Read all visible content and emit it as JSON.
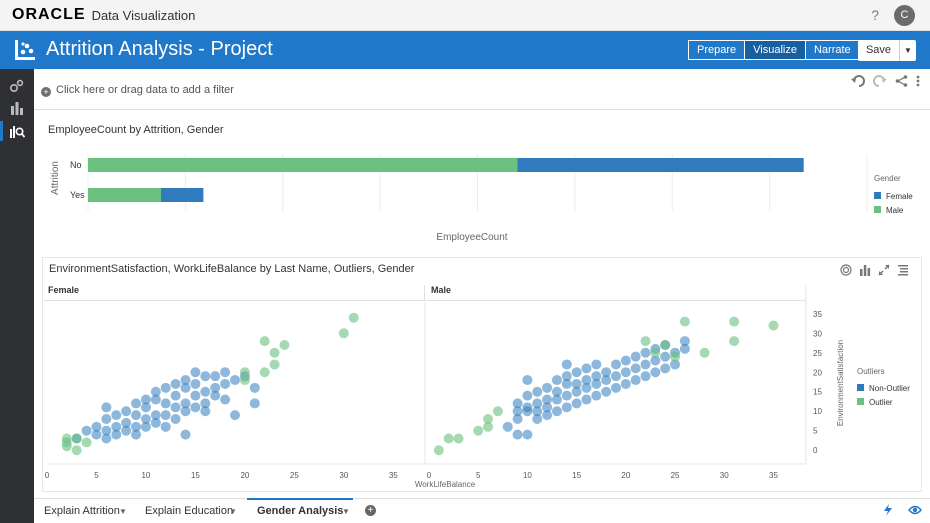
{
  "app": {
    "brand": "ORACLE",
    "product": "Data Visualization",
    "help": "?",
    "user_initial": "C"
  },
  "project": {
    "title": "Attrition Analysis - Project",
    "modes": [
      "Prepare",
      "Visualize",
      "Narrate"
    ],
    "active_mode": "Visualize",
    "save_label": "Save"
  },
  "rail": {
    "items": [
      "data-icon",
      "visualize-icon",
      "explain-icon"
    ]
  },
  "filter": {
    "placeholder": "Click here or drag data to add a filter"
  },
  "viz1": {
    "title": "EmployeeCount by Attrition, Gender",
    "chart_data": {
      "type": "bar",
      "orientation": "horizontal",
      "stacked": true,
      "categories": [
        "No",
        "Yes"
      ],
      "ylabel": "Attrition",
      "xlabel": "EmployeeCount",
      "series": [
        {
          "name": "Male",
          "values": [
            882,
            150
          ],
          "color": "#6ac07e"
        },
        {
          "name": "Female",
          "values": [
            588,
            87
          ],
          "color": "#2f7bbd"
        }
      ],
      "legend_title": "Gender",
      "legend": [
        "Female",
        "Male"
      ],
      "xlim": [
        0,
        1600
      ]
    }
  },
  "viz2": {
    "title": "EnvironmentSatisfaction, WorkLifeBalance by Last Name, Outliers, Gender",
    "panels": [
      "Female",
      "Male"
    ],
    "xlabel": "WorkLifeBalance",
    "ylabel": "EnvironmentSatisfaction",
    "legend_title": "Outliers",
    "legend": [
      {
        "name": "Non-Outlier",
        "color": "#2f7bbd"
      },
      {
        "name": "Outlier",
        "color": "#6ac07e"
      }
    ],
    "chart_data": {
      "type": "scatter",
      "xlim": [
        0,
        38
      ],
      "ylim": [
        -2,
        37
      ],
      "xticks": [
        0,
        5,
        10,
        15,
        20,
        25,
        30,
        35
      ],
      "yticks": [
        0,
        5,
        10,
        15,
        20,
        25,
        30,
        35
      ],
      "Female": {
        "Non-Outlier": [
          [
            3,
            3
          ],
          [
            4,
            5
          ],
          [
            5,
            4
          ],
          [
            5,
            6
          ],
          [
            6,
            3
          ],
          [
            6,
            5
          ],
          [
            6,
            8
          ],
          [
            7,
            4
          ],
          [
            7,
            6
          ],
          [
            7,
            9
          ],
          [
            8,
            5
          ],
          [
            8,
            7
          ],
          [
            8,
            10
          ],
          [
            9,
            4
          ],
          [
            9,
            6
          ],
          [
            9,
            9
          ],
          [
            10,
            6
          ],
          [
            10,
            8
          ],
          [
            10,
            11
          ],
          [
            11,
            7
          ],
          [
            11,
            9
          ],
          [
            11,
            13
          ],
          [
            11,
            15
          ],
          [
            12,
            6
          ],
          [
            12,
            9
          ],
          [
            12,
            12
          ],
          [
            12,
            16
          ],
          [
            13,
            8
          ],
          [
            13,
            11
          ],
          [
            13,
            14
          ],
          [
            13,
            17
          ],
          [
            14,
            10
          ],
          [
            14,
            12
          ],
          [
            14,
            16
          ],
          [
            14,
            18
          ],
          [
            15,
            11
          ],
          [
            15,
            14
          ],
          [
            15,
            17
          ],
          [
            15,
            20
          ],
          [
            16,
            12
          ],
          [
            16,
            15
          ],
          [
            16,
            19
          ],
          [
            17,
            14
          ],
          [
            17,
            16
          ],
          [
            17,
            19
          ],
          [
            18,
            13
          ],
          [
            18,
            17
          ],
          [
            18,
            20
          ],
          [
            19,
            18
          ],
          [
            20,
            19
          ],
          [
            21,
            16
          ],
          [
            21,
            12
          ],
          [
            16,
            10
          ],
          [
            14,
            4
          ],
          [
            19,
            9
          ],
          [
            6,
            11
          ],
          [
            10,
            13
          ],
          [
            9,
            12
          ]
        ],
        "Outlier": [
          [
            2,
            1
          ],
          [
            2,
            2
          ],
          [
            3,
            3
          ],
          [
            3,
            0
          ],
          [
            22,
            28
          ],
          [
            22,
            20
          ],
          [
            23,
            25
          ],
          [
            24,
            27
          ],
          [
            23,
            22
          ],
          [
            20,
            20
          ],
          [
            20,
            18
          ],
          [
            30,
            30
          ],
          [
            31,
            34
          ],
          [
            2,
            3
          ],
          [
            4,
            2
          ]
        ]
      },
      "Male": {
        "Non-Outlier": [
          [
            9,
            8
          ],
          [
            9,
            10
          ],
          [
            9,
            12
          ],
          [
            10,
            4
          ],
          [
            10,
            10
          ],
          [
            10,
            11
          ],
          [
            10,
            14
          ],
          [
            10,
            18
          ],
          [
            11,
            8
          ],
          [
            11,
            10
          ],
          [
            11,
            12
          ],
          [
            11,
            15
          ],
          [
            12,
            9
          ],
          [
            12,
            11
          ],
          [
            12,
            13
          ],
          [
            12,
            16
          ],
          [
            13,
            10
          ],
          [
            13,
            13
          ],
          [
            13,
            15
          ],
          [
            13,
            18
          ],
          [
            14,
            11
          ],
          [
            14,
            14
          ],
          [
            14,
            17
          ],
          [
            14,
            19
          ],
          [
            14,
            22
          ],
          [
            15,
            12
          ],
          [
            15,
            15
          ],
          [
            15,
            17
          ],
          [
            15,
            20
          ],
          [
            16,
            13
          ],
          [
            16,
            16
          ],
          [
            16,
            18
          ],
          [
            16,
            21
          ],
          [
            17,
            14
          ],
          [
            17,
            17
          ],
          [
            17,
            19
          ],
          [
            17,
            22
          ],
          [
            18,
            15
          ],
          [
            18,
            18
          ],
          [
            18,
            20
          ],
          [
            19,
            16
          ],
          [
            19,
            19
          ],
          [
            19,
            22
          ],
          [
            20,
            17
          ],
          [
            20,
            20
          ],
          [
            20,
            23
          ],
          [
            21,
            18
          ],
          [
            21,
            21
          ],
          [
            21,
            24
          ],
          [
            22,
            19
          ],
          [
            22,
            22
          ],
          [
            22,
            25
          ],
          [
            23,
            20
          ],
          [
            23,
            23
          ],
          [
            23,
            26
          ],
          [
            24,
            21
          ],
          [
            24,
            24
          ],
          [
            24,
            27
          ],
          [
            25,
            22
          ],
          [
            25,
            25
          ],
          [
            26,
            26
          ],
          [
            26,
            28
          ],
          [
            8,
            6
          ],
          [
            9,
            4
          ]
        ],
        "Outlier": [
          [
            1,
            0
          ],
          [
            2,
            3
          ],
          [
            3,
            3
          ],
          [
            5,
            5
          ],
          [
            6,
            6
          ],
          [
            6,
            8
          ],
          [
            7,
            10
          ],
          [
            22,
            28
          ],
          [
            23,
            25
          ],
          [
            24,
            27
          ],
          [
            25,
            24
          ],
          [
            26,
            33
          ],
          [
            28,
            25
          ],
          [
            31,
            33
          ],
          [
            31,
            28
          ],
          [
            35,
            32
          ]
        ]
      }
    }
  },
  "tabs": {
    "items": [
      "Explain Attrition",
      "Explain Education",
      "Gender Analysis"
    ],
    "active": "Gender Analysis"
  }
}
